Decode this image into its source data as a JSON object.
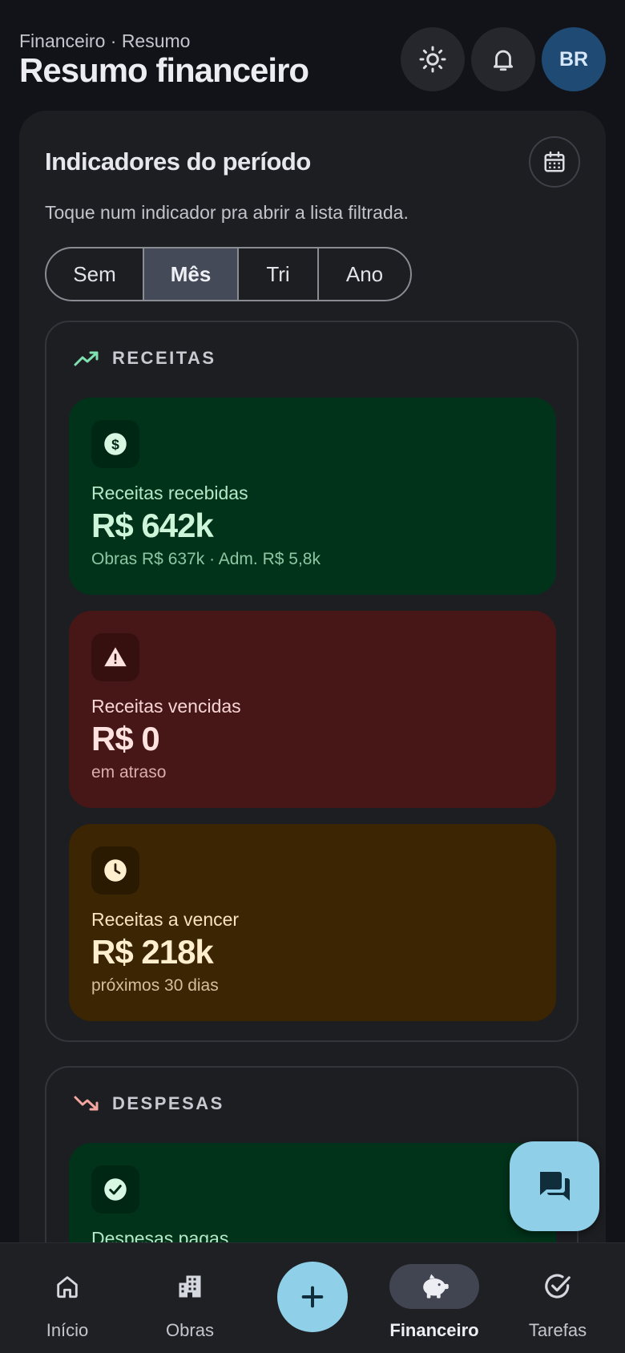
{
  "header": {
    "breadcrumb": "Financeiro · Resumo",
    "title": "Resumo financeiro",
    "avatar_initials": "BR",
    "icons": [
      "sun-icon",
      "bell-icon"
    ]
  },
  "indicators": {
    "title": "Indicadores do período",
    "hint": "Toque num indicador pra abrir a lista filtrada.",
    "periods": [
      "Sem",
      "Mês",
      "Tri",
      "Ano"
    ],
    "selected_period": "Mês"
  },
  "receitas": {
    "label": "RECEITAS",
    "icon": "trending-up-icon",
    "accent": "#7fe0b0",
    "cards": [
      {
        "label": "Receitas recebidas",
        "value": "R$ 642k",
        "sub": "Obras R$ 637k · Adm. R$ 5,8k",
        "icon": "dollar-icon",
        "color": "#00331a"
      },
      {
        "label": "Receitas vencidas",
        "value": "R$ 0",
        "sub": "em atraso",
        "icon": "warning-icon",
        "color": "#471617"
      },
      {
        "label": "Receitas a vencer",
        "value": "R$ 218k",
        "sub": "próximos 30 dias",
        "icon": "clock-icon",
        "color": "#3b2503"
      }
    ]
  },
  "despesas": {
    "label": "DESPESAS",
    "icon": "trending-down-icon",
    "accent": "#f4a6a0",
    "cards": [
      {
        "label": "Despesas pagas",
        "icon": "check-circle-icon",
        "color": "#00331a"
      }
    ]
  },
  "nav": {
    "items": [
      "Início",
      "Obras",
      "Financeiro",
      "Tarefas"
    ],
    "active": "Financeiro",
    "add_icon": "plus-icon"
  },
  "chat_icon": "chat-icon"
}
